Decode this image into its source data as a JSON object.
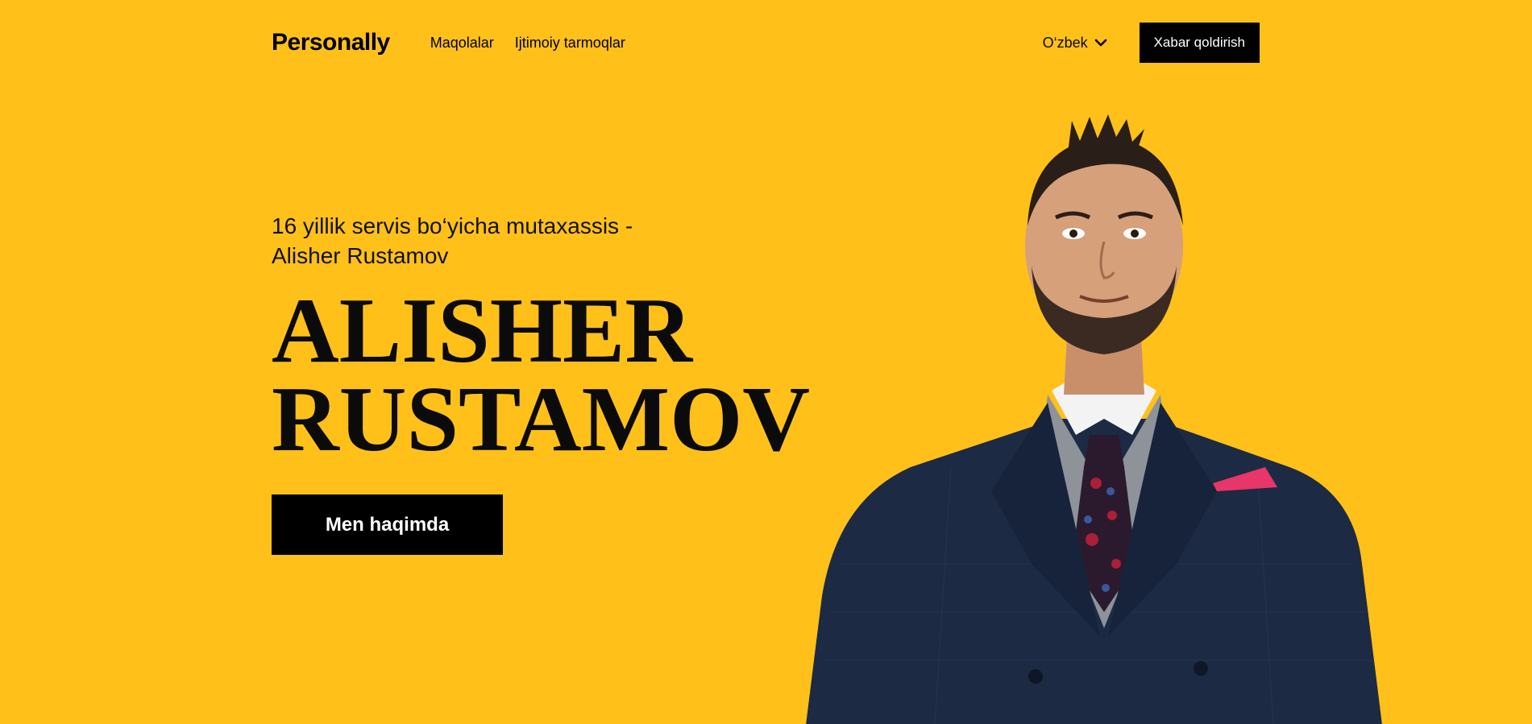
{
  "header": {
    "logo": "Personally",
    "nav": [
      {
        "label": "Maqolalar"
      },
      {
        "label": "Ijtimoiy tarmoqlar"
      }
    ],
    "language": "O‘zbek",
    "contact_button": "Xabar qoldirish"
  },
  "hero": {
    "kicker": "16 yillik servis bo‘yicha mutaxassis - Alisher Rustamov",
    "title_line1": "ALISHER",
    "title_line2": "RUSTAMOV",
    "about_button": "Men haqimda"
  },
  "theme": {
    "background": "#FFC01A",
    "button_bg": "#000000",
    "button_text": "#FFFFFF",
    "suit_color": "#1c2a44"
  },
  "icons": {
    "language_chevron": "chevron-down-icon"
  }
}
